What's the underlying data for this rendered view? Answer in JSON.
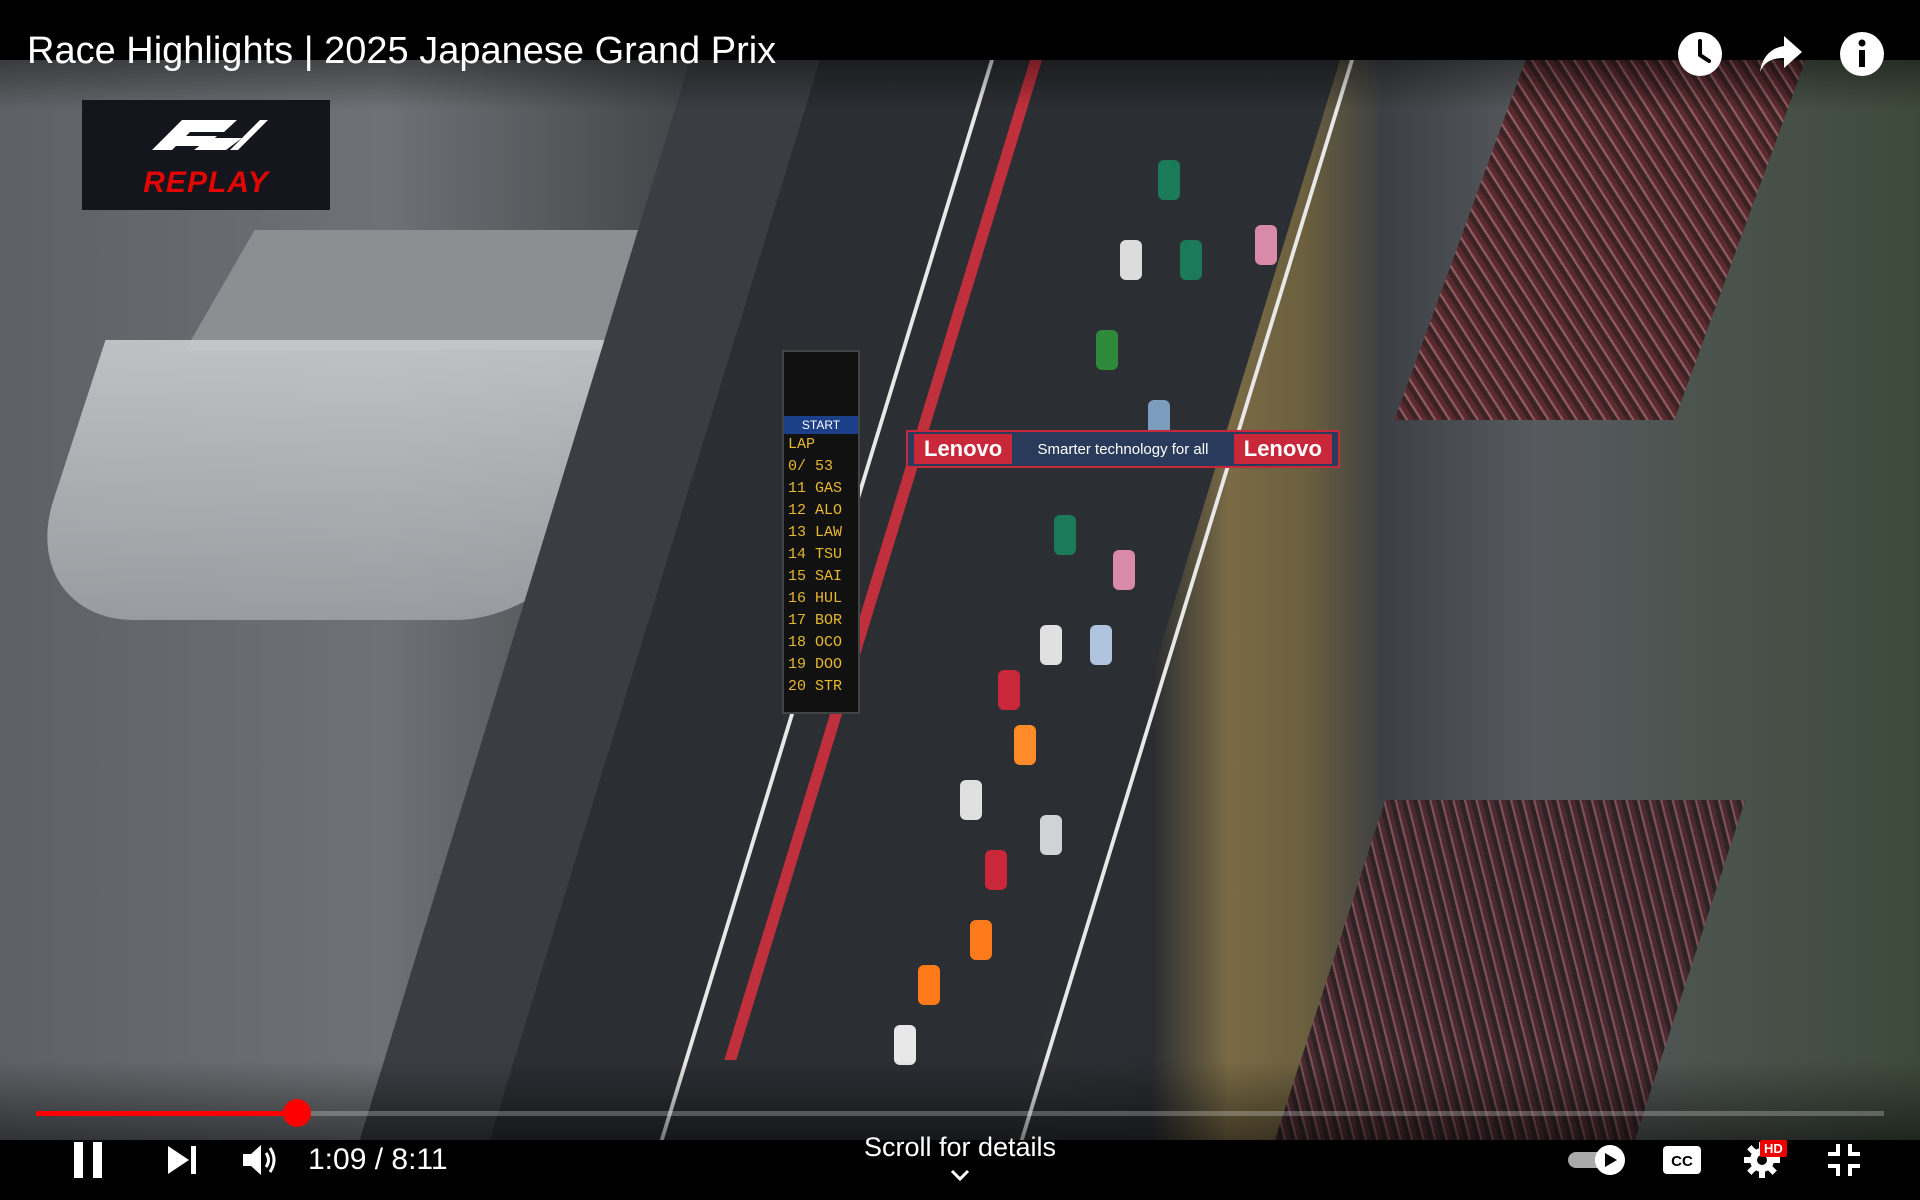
{
  "video": {
    "title": "Race Highlights | 2025 Japanese Grand Prix",
    "badge_text": "REPLAY",
    "scene": {
      "gantry_brand_left": "Lenovo",
      "gantry_tagline": "Smarter technology for all",
      "gantry_brand_right": "Lenovo",
      "tower_start": "START",
      "tower_lap_header": "LAP",
      "tower_lap_count": "0/ 53",
      "tower_rows": [
        "11 GAS",
        "12 ALO",
        "13 LAW",
        "14 TSU",
        "15 SAI",
        "16 HUL",
        "17 BOR",
        "18 OCO",
        "19 DOO",
        "20 STR"
      ]
    }
  },
  "top_controls": [
    {
      "name": "watch-later-icon"
    },
    {
      "name": "share-icon"
    },
    {
      "name": "info-icon"
    }
  ],
  "player": {
    "progress_fraction": 0.1415,
    "current_time": "1:09",
    "separator": " / ",
    "duration": "8:11",
    "time_display": "1:09 / 8:11",
    "scroll_hint": "Scroll for details",
    "quality_badge": "HD",
    "accent_color": "#ff0000"
  }
}
